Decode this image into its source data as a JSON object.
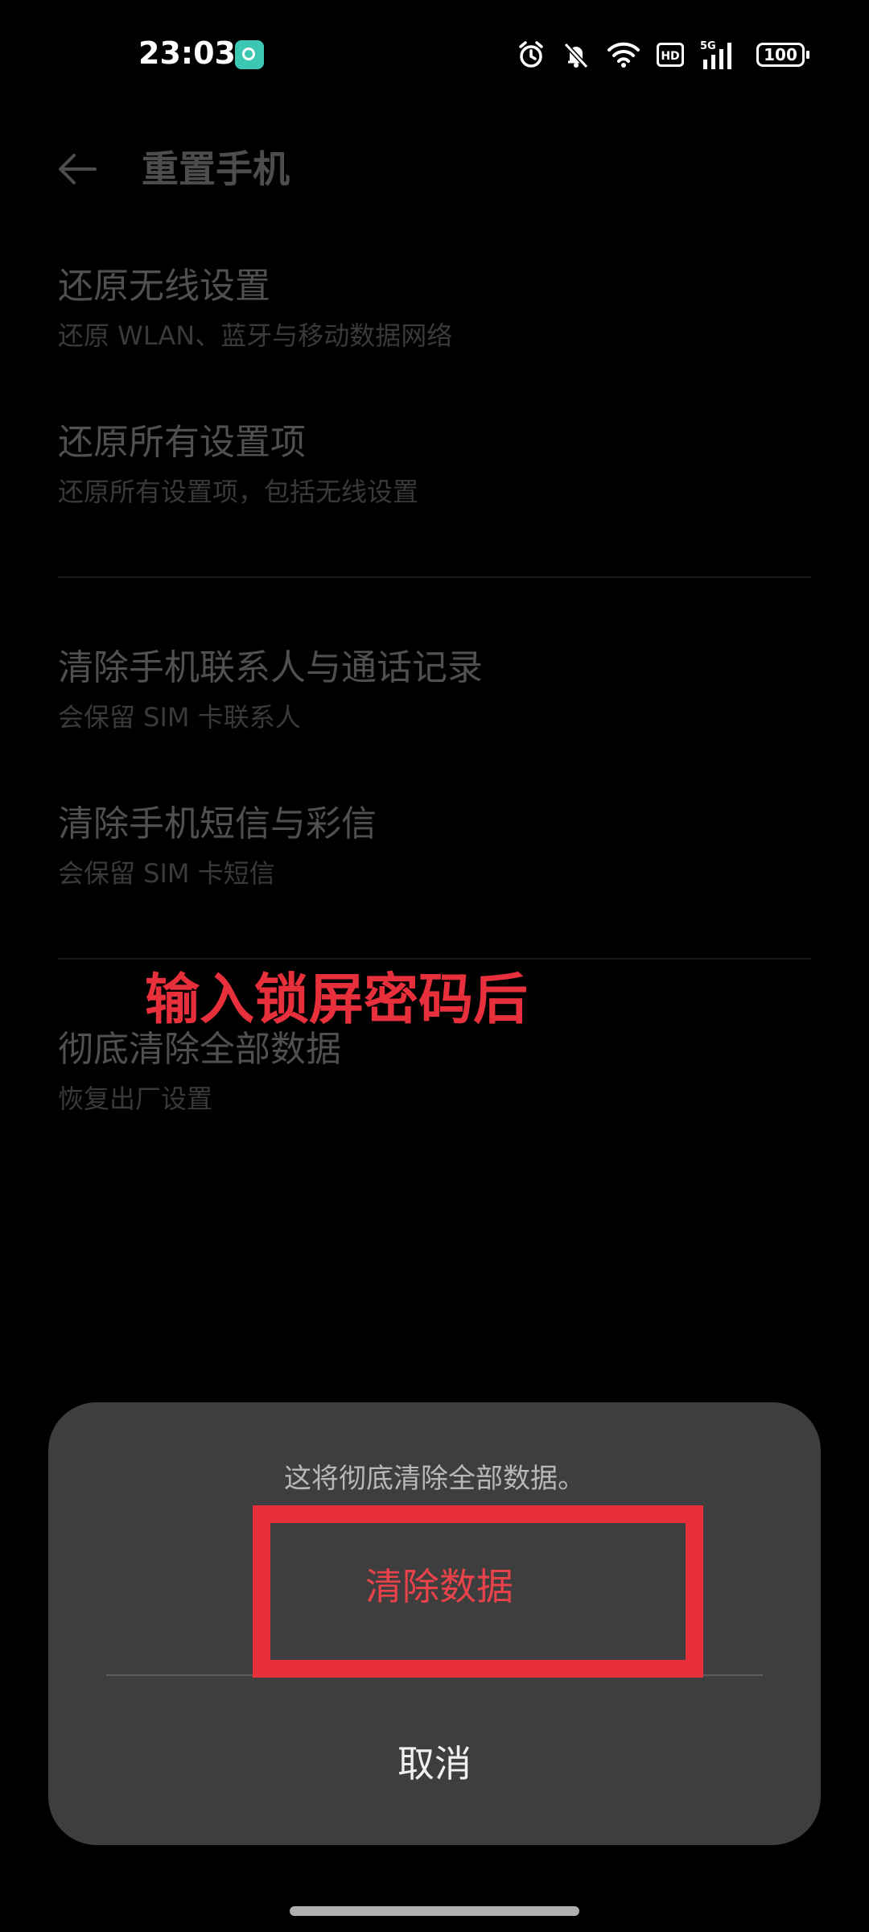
{
  "status_bar": {
    "time": "23:03",
    "battery": "100",
    "icons": [
      "alarm-icon",
      "mute-icon",
      "wifi-icon",
      "hd-icon",
      "5g-signal-icon",
      "battery-icon"
    ]
  },
  "header": {
    "title": "重置手机",
    "back_icon": "arrow-left-icon"
  },
  "items": [
    {
      "title": "还原无线设置",
      "subtitle": "还原 WLAN、蓝牙与移动数据网络"
    },
    {
      "title": "还原所有设置项",
      "subtitle": "还原所有设置项，包括无线设置"
    },
    {
      "title": "清除手机联系人与通话记录",
      "subtitle": "会保留 SIM 卡联系人"
    },
    {
      "title": "清除手机短信与彩信",
      "subtitle": "会保留 SIM 卡短信"
    },
    {
      "title": "彻底清除全部数据",
      "subtitle": "恢复出厂设置"
    }
  ],
  "annotation": "输入锁屏密码后",
  "dialog": {
    "message": "这将彻底清除全部数据。",
    "confirm_label": "清除数据",
    "cancel_label": "取消"
  },
  "colors": {
    "accent_red": "#e8303c",
    "dialog_bg": "#3e3e3e",
    "background": "#000000"
  }
}
